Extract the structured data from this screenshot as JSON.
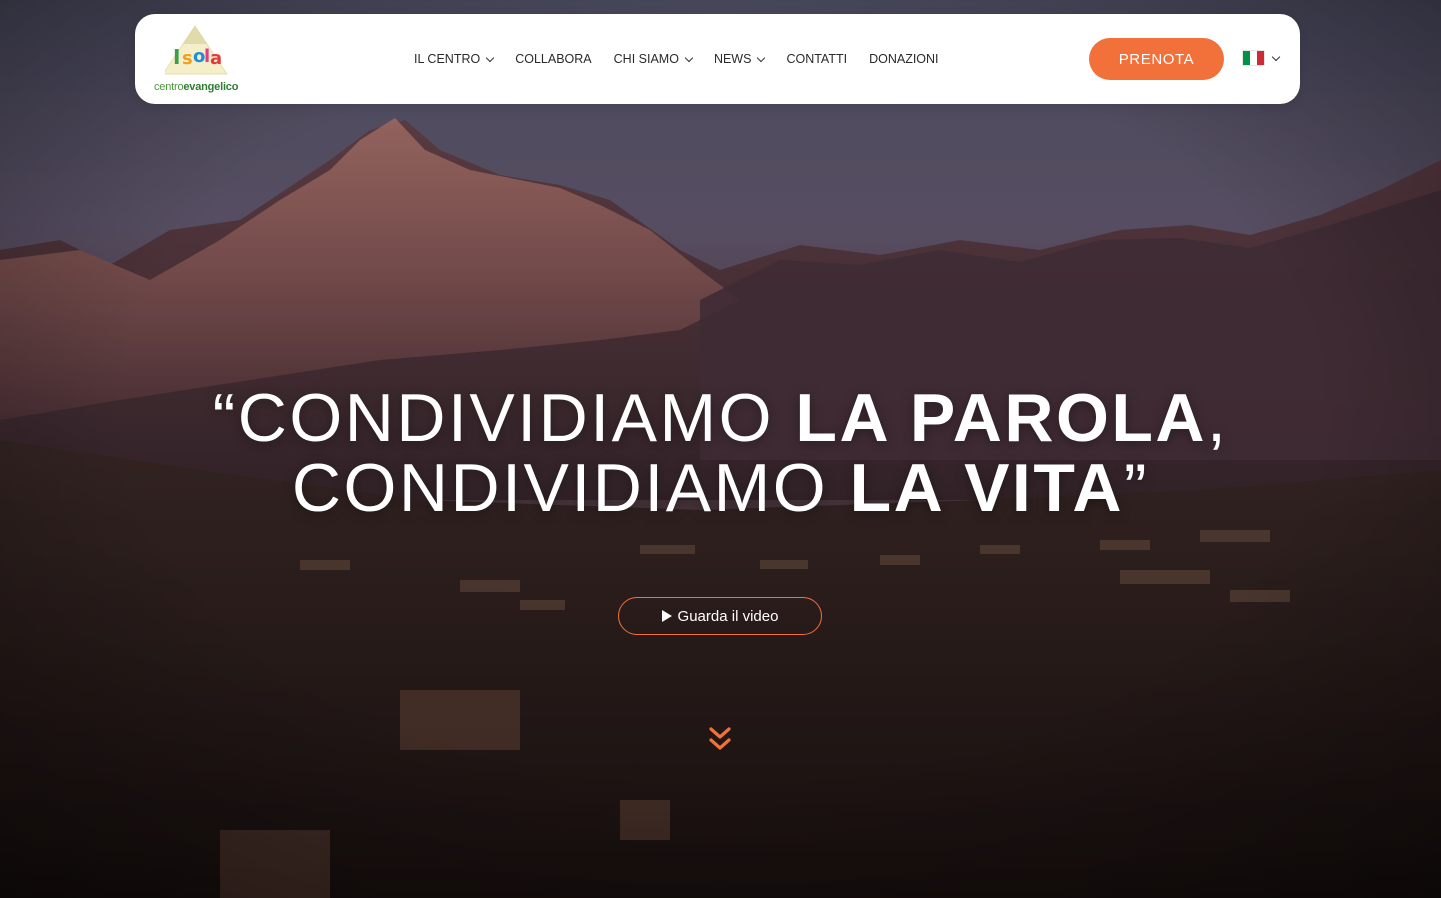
{
  "logo": {
    "wordmark": "Isola",
    "caption_light": "centro",
    "caption_bold": "evangelico"
  },
  "nav": {
    "items": [
      {
        "label": "IL CENTRO",
        "has_dropdown": true
      },
      {
        "label": "COLLABORA",
        "has_dropdown": false
      },
      {
        "label": "CHI SIAMO",
        "has_dropdown": true
      },
      {
        "label": "NEWS",
        "has_dropdown": true
      },
      {
        "label": "CONTATTI",
        "has_dropdown": false
      },
      {
        "label": "DONAZIONI",
        "has_dropdown": false
      }
    ]
  },
  "header": {
    "book_label": "PRENOTA",
    "language_icon": "italy-flag-icon"
  },
  "hero": {
    "line1_light": "“CONDIVIDIAMO ",
    "line1_bold": "LA PAROLA",
    "line1_end": ",",
    "line2_light": "CONDIVIDIAMO ",
    "line2_bold": "LA VITA",
    "line2_end": "”",
    "video_label": "Guarda il video",
    "scroll_icon": "double-chevron-down-icon"
  },
  "colors": {
    "accent": "#f2703a",
    "header_bg": "#ffffff",
    "nav_text": "#2a2a2a",
    "flag_green": "#009246",
    "flag_white": "#ffffff",
    "flag_red": "#ce2b37"
  }
}
